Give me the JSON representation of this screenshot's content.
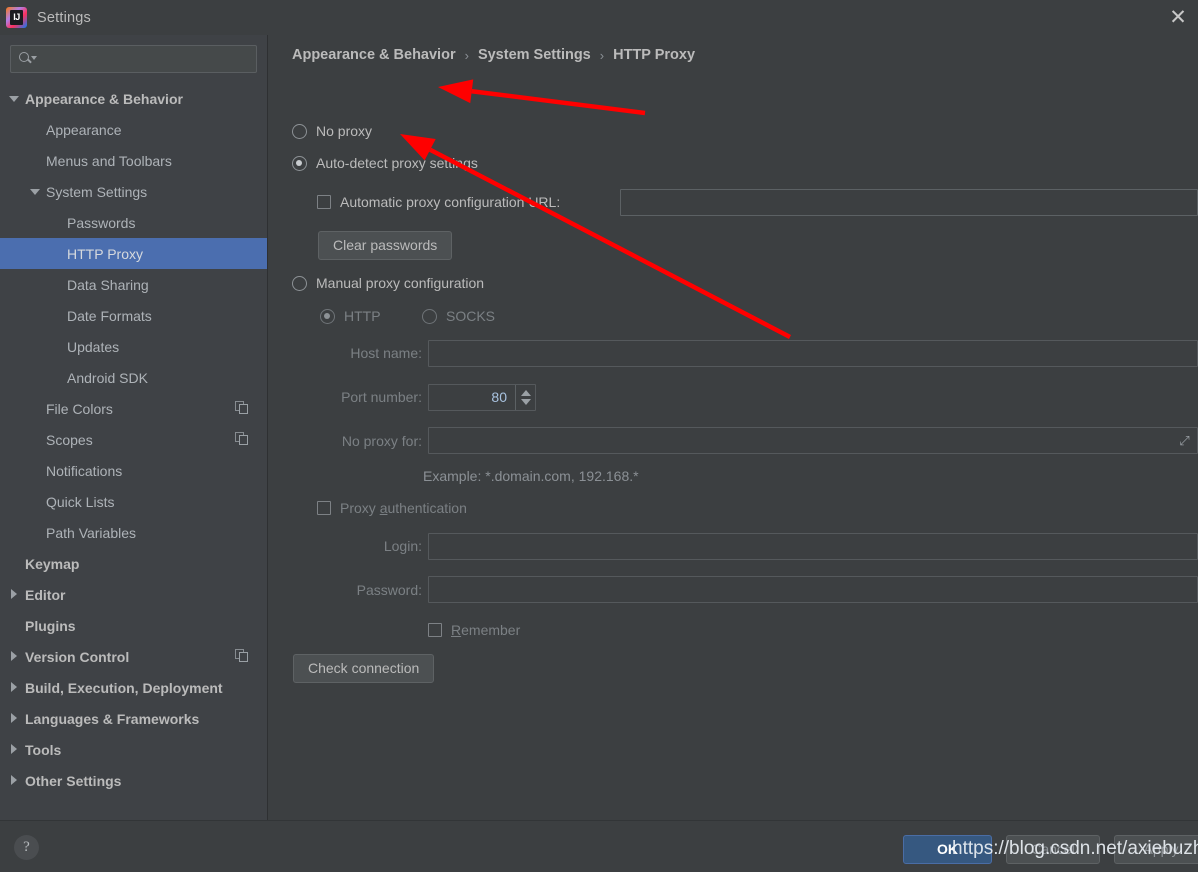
{
  "window": {
    "title": "Settings",
    "logo_icon": "intellij-idea-logo",
    "close_icon": "close-icon"
  },
  "sidebar": {
    "search": {
      "placeholder": "",
      "value": "",
      "icon": "search-icon",
      "dropdown_icon": "chevron-down-icon"
    },
    "items": [
      {
        "label": "Appearance & Behavior",
        "indent": 0,
        "twisty": "down",
        "bold": true,
        "selected": false,
        "copy": false
      },
      {
        "label": "Appearance",
        "indent": 1,
        "twisty": "none",
        "bold": false,
        "selected": false,
        "copy": false
      },
      {
        "label": "Menus and Toolbars",
        "indent": 1,
        "twisty": "none",
        "bold": false,
        "selected": false,
        "copy": false
      },
      {
        "label": "System Settings",
        "indent": 1,
        "twisty": "down",
        "bold": false,
        "selected": false,
        "copy": false
      },
      {
        "label": "Passwords",
        "indent": 2,
        "twisty": "none",
        "bold": false,
        "selected": false,
        "copy": false
      },
      {
        "label": "HTTP Proxy",
        "indent": 2,
        "twisty": "none",
        "bold": false,
        "selected": true,
        "copy": false
      },
      {
        "label": "Data Sharing",
        "indent": 2,
        "twisty": "none",
        "bold": false,
        "selected": false,
        "copy": false
      },
      {
        "label": "Date Formats",
        "indent": 2,
        "twisty": "none",
        "bold": false,
        "selected": false,
        "copy": false
      },
      {
        "label": "Updates",
        "indent": 2,
        "twisty": "none",
        "bold": false,
        "selected": false,
        "copy": false
      },
      {
        "label": "Android SDK",
        "indent": 2,
        "twisty": "none",
        "bold": false,
        "selected": false,
        "copy": false
      },
      {
        "label": "File Colors",
        "indent": 1,
        "twisty": "none",
        "bold": false,
        "selected": false,
        "copy": true
      },
      {
        "label": "Scopes",
        "indent": 1,
        "twisty": "none",
        "bold": false,
        "selected": false,
        "copy": true
      },
      {
        "label": "Notifications",
        "indent": 1,
        "twisty": "none",
        "bold": false,
        "selected": false,
        "copy": false
      },
      {
        "label": "Quick Lists",
        "indent": 1,
        "twisty": "none",
        "bold": false,
        "selected": false,
        "copy": false
      },
      {
        "label": "Path Variables",
        "indent": 1,
        "twisty": "none",
        "bold": false,
        "selected": false,
        "copy": false
      },
      {
        "label": "Keymap",
        "indent": 0,
        "twisty": "none",
        "bold": true,
        "selected": false,
        "copy": false
      },
      {
        "label": "Editor",
        "indent": 0,
        "twisty": "right",
        "bold": true,
        "selected": false,
        "copy": false
      },
      {
        "label": "Plugins",
        "indent": 0,
        "twisty": "none",
        "bold": true,
        "selected": false,
        "copy": false
      },
      {
        "label": "Version Control",
        "indent": 0,
        "twisty": "right",
        "bold": true,
        "selected": false,
        "copy": true
      },
      {
        "label": "Build, Execution, Deployment",
        "indent": 0,
        "twisty": "right",
        "bold": true,
        "selected": false,
        "copy": false
      },
      {
        "label": "Languages & Frameworks",
        "indent": 0,
        "twisty": "right",
        "bold": true,
        "selected": false,
        "copy": false
      },
      {
        "label": "Tools",
        "indent": 0,
        "twisty": "right",
        "bold": true,
        "selected": false,
        "copy": false
      },
      {
        "label": "Other Settings",
        "indent": 0,
        "twisty": "right",
        "bold": true,
        "selected": false,
        "copy": false
      }
    ]
  },
  "breadcrumb": {
    "crumb1": "Appearance & Behavior",
    "crumb2": "System Settings",
    "crumb3": "HTTP Proxy",
    "separator": "›"
  },
  "main": {
    "no_proxy": {
      "label": "No proxy",
      "checked": false
    },
    "auto_detect": {
      "label": "Auto-detect proxy settings",
      "checked": true
    },
    "auto_config_url": {
      "label": "Automatic proxy configuration URL:",
      "checked": false,
      "value": ""
    },
    "clear_passwords": {
      "label": "Clear passwords"
    },
    "manual_proxy": {
      "label": "Manual proxy configuration",
      "checked": false
    },
    "http_radio": {
      "label": "HTTP",
      "checked": true
    },
    "socks_radio": {
      "label": "SOCKS",
      "checked": false
    },
    "host_name": {
      "label": "Host name:",
      "value": ""
    },
    "port_number": {
      "label": "Port number:",
      "value": "80"
    },
    "no_proxy_for": {
      "label": "No proxy for:",
      "value": "",
      "expand_icon": "expand-icon"
    },
    "example_hint": "Example: *.domain.com, 192.168.*",
    "proxy_auth": {
      "label_pre": "Proxy ",
      "label_mnemonic": "a",
      "label_post": "uthentication",
      "checked": false
    },
    "login": {
      "label": "Login:",
      "value": ""
    },
    "password": {
      "label": "Password:",
      "value": ""
    },
    "remember": {
      "label_mnemonic": "R",
      "label_post": "emember",
      "checked": false
    },
    "check_connection": {
      "label": "Check connection"
    }
  },
  "footer": {
    "help_label": "?",
    "ok_label": "OK",
    "cancel_label": "Cancel",
    "apply_label": "Apply"
  },
  "annotations": {
    "watermark": "https://blog.csdn.net/axiebuzhen",
    "arrow_color": "#ff0000",
    "arrow_count": 2
  },
  "colors": {
    "background": "#3c3f41",
    "sidebar": "#3f4246",
    "selection": "#4b6eaf",
    "accent_button": "#365880",
    "text": "#bbbbbb",
    "text_dim": "#7b8084"
  }
}
